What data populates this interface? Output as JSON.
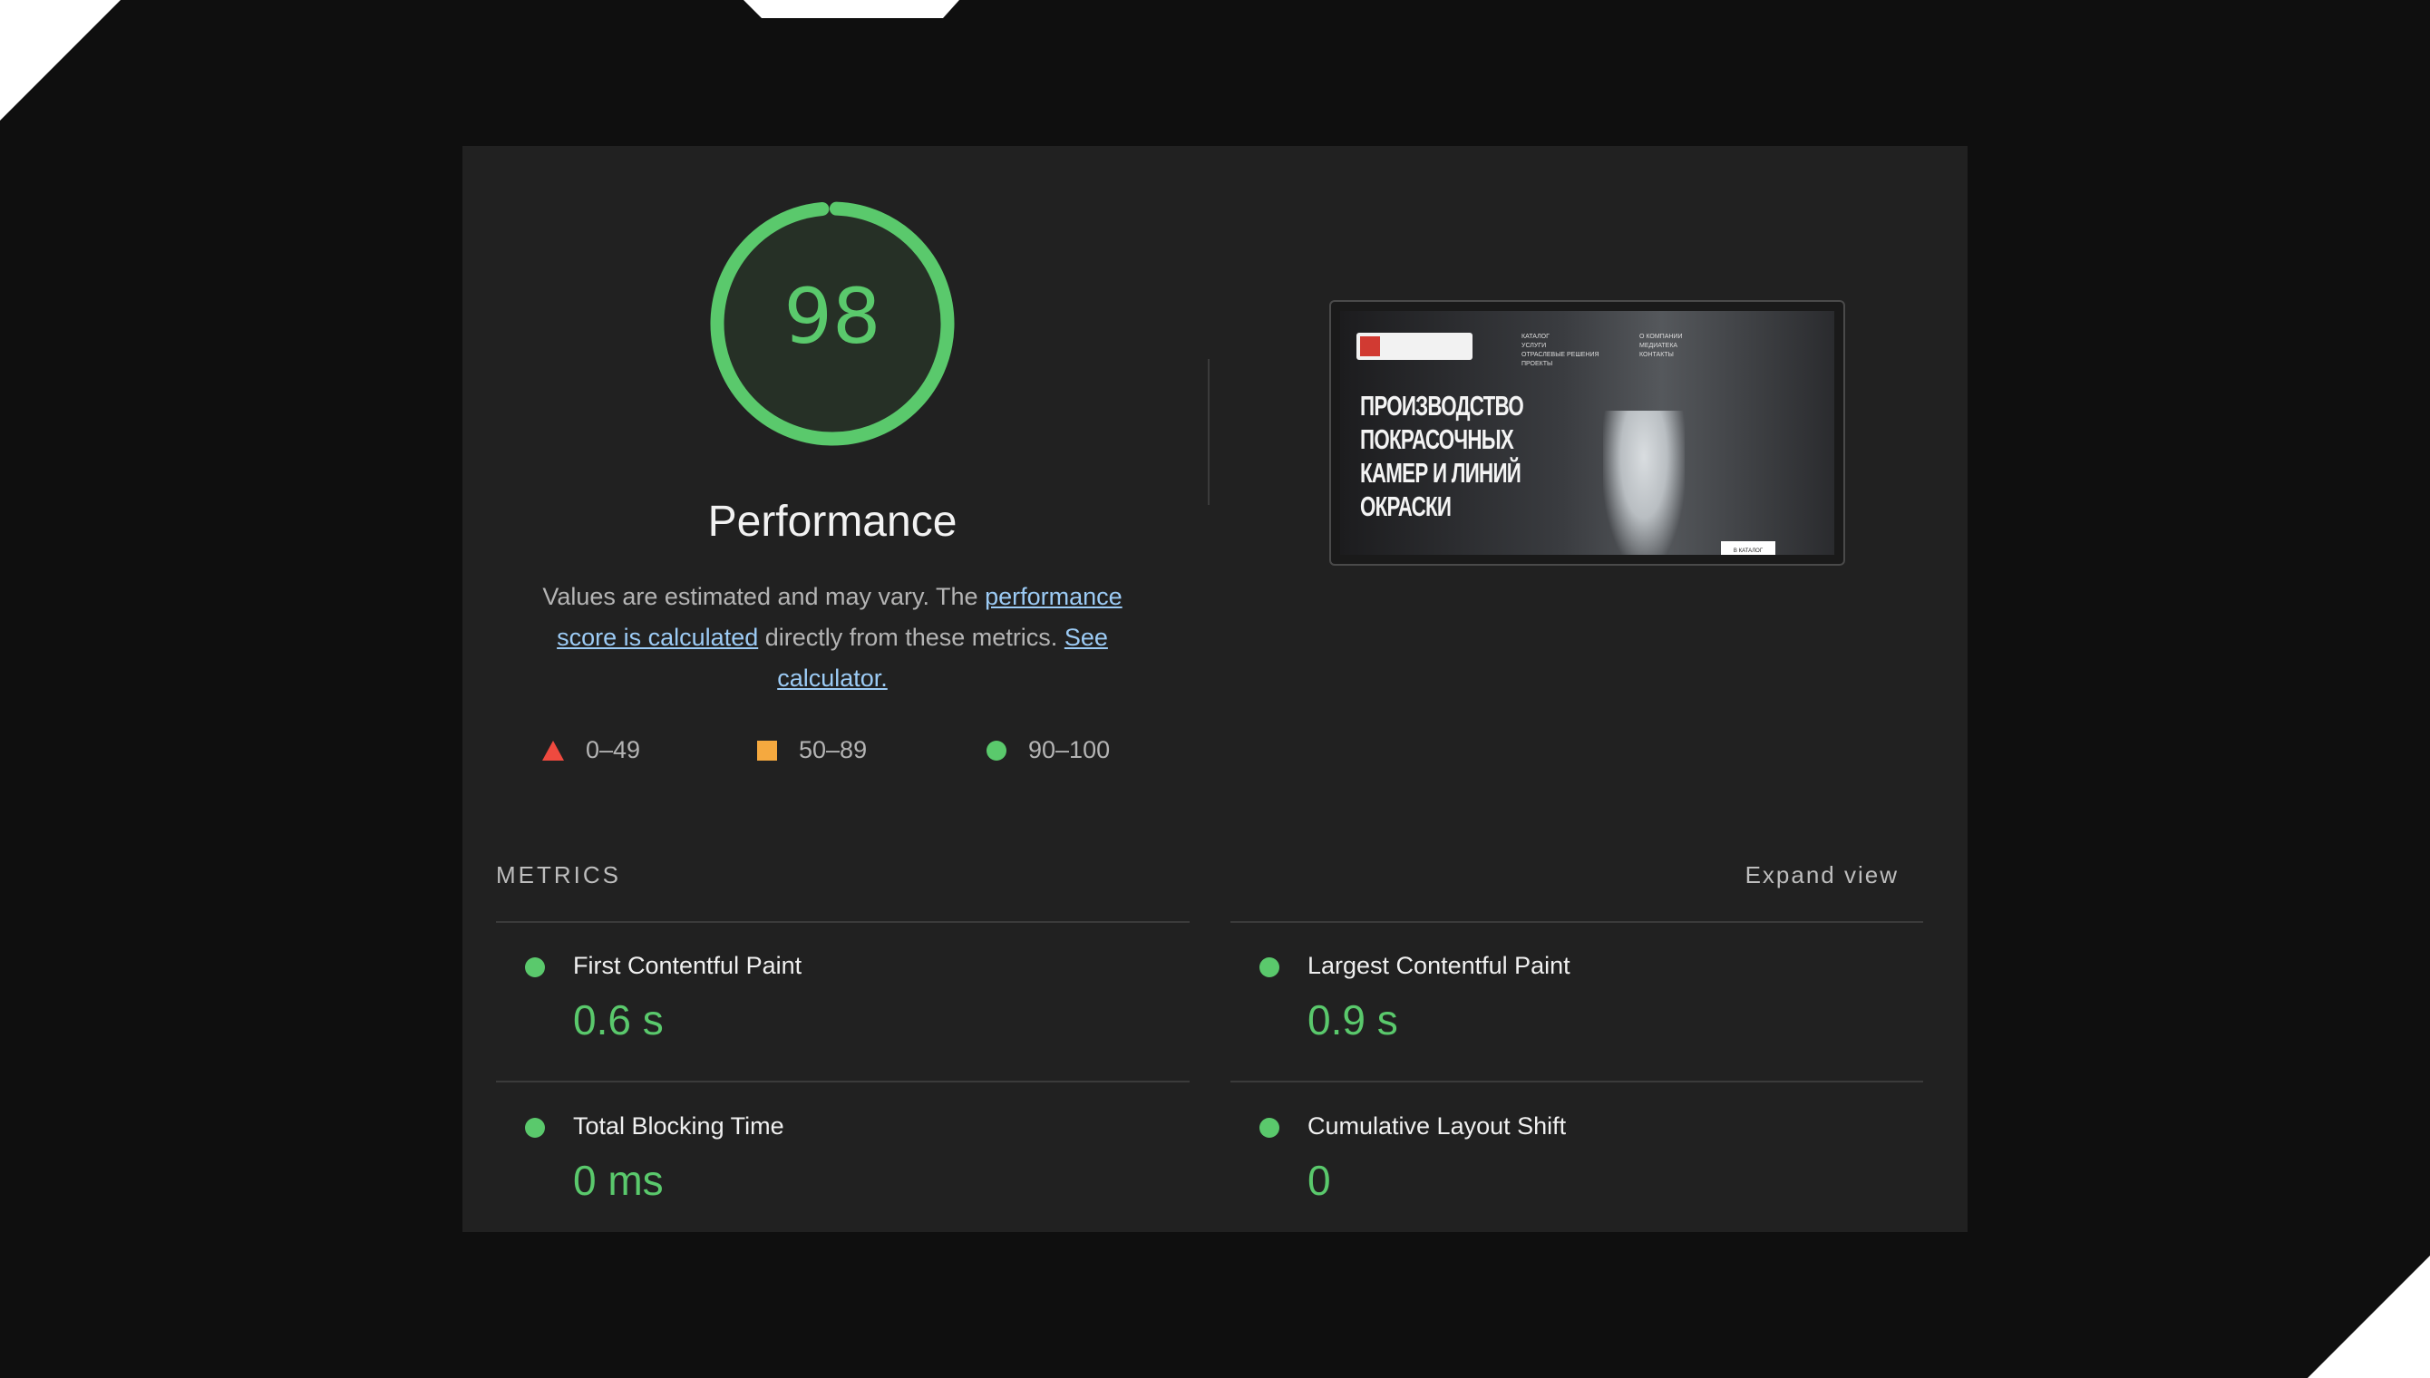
{
  "colors": {
    "pass": "#5ac96c",
    "average": "#f5a93f",
    "fail": "#ef4a3f",
    "link": "#9ccbf5",
    "panel": "#212121",
    "background": "#0f0f0f"
  },
  "gauge": {
    "score": "98",
    "fraction": 0.98
  },
  "category_title": "Performance",
  "description": {
    "text1": "Values are estimated and may vary. The ",
    "link1": "performance score is calculated",
    "text2": " directly from these metrics. ",
    "link2": "See calculator."
  },
  "legend": [
    {
      "icon": "triangle-icon",
      "label": "0–49"
    },
    {
      "icon": "square-icon",
      "label": "50–89"
    },
    {
      "icon": "circle-icon",
      "label": "90–100"
    }
  ],
  "screenshot": {
    "hero": [
      "ПРОИЗВОДСТВО",
      "ПОКРАСОЧНЫХ",
      "КАМЕР И ЛИНИЙ",
      "ОКРАСКИ"
    ],
    "nav1": [
      "КАТАЛОГ",
      "УСЛУГИ",
      "ОТРАСЛЕВЫЕ РЕШЕНИЯ",
      "ПРОЕКТЫ"
    ],
    "nav2": [
      "О КОМПАНИИ",
      "МЕДИАТЕКА",
      "КОНТАКТЫ"
    ],
    "button": "В КАТАЛОГ"
  },
  "metrics": {
    "heading": "METRICS",
    "expand_label": "Expand view",
    "items": [
      {
        "title": "First Contentful Paint",
        "value": "0.6 s",
        "status": "pass"
      },
      {
        "title": "Largest Contentful Paint",
        "value": "0.9 s",
        "status": "pass"
      },
      {
        "title": "Total Blocking Time",
        "value": "0 ms",
        "status": "pass"
      },
      {
        "title": "Cumulative Layout Shift",
        "value": "0",
        "status": "pass"
      }
    ]
  }
}
